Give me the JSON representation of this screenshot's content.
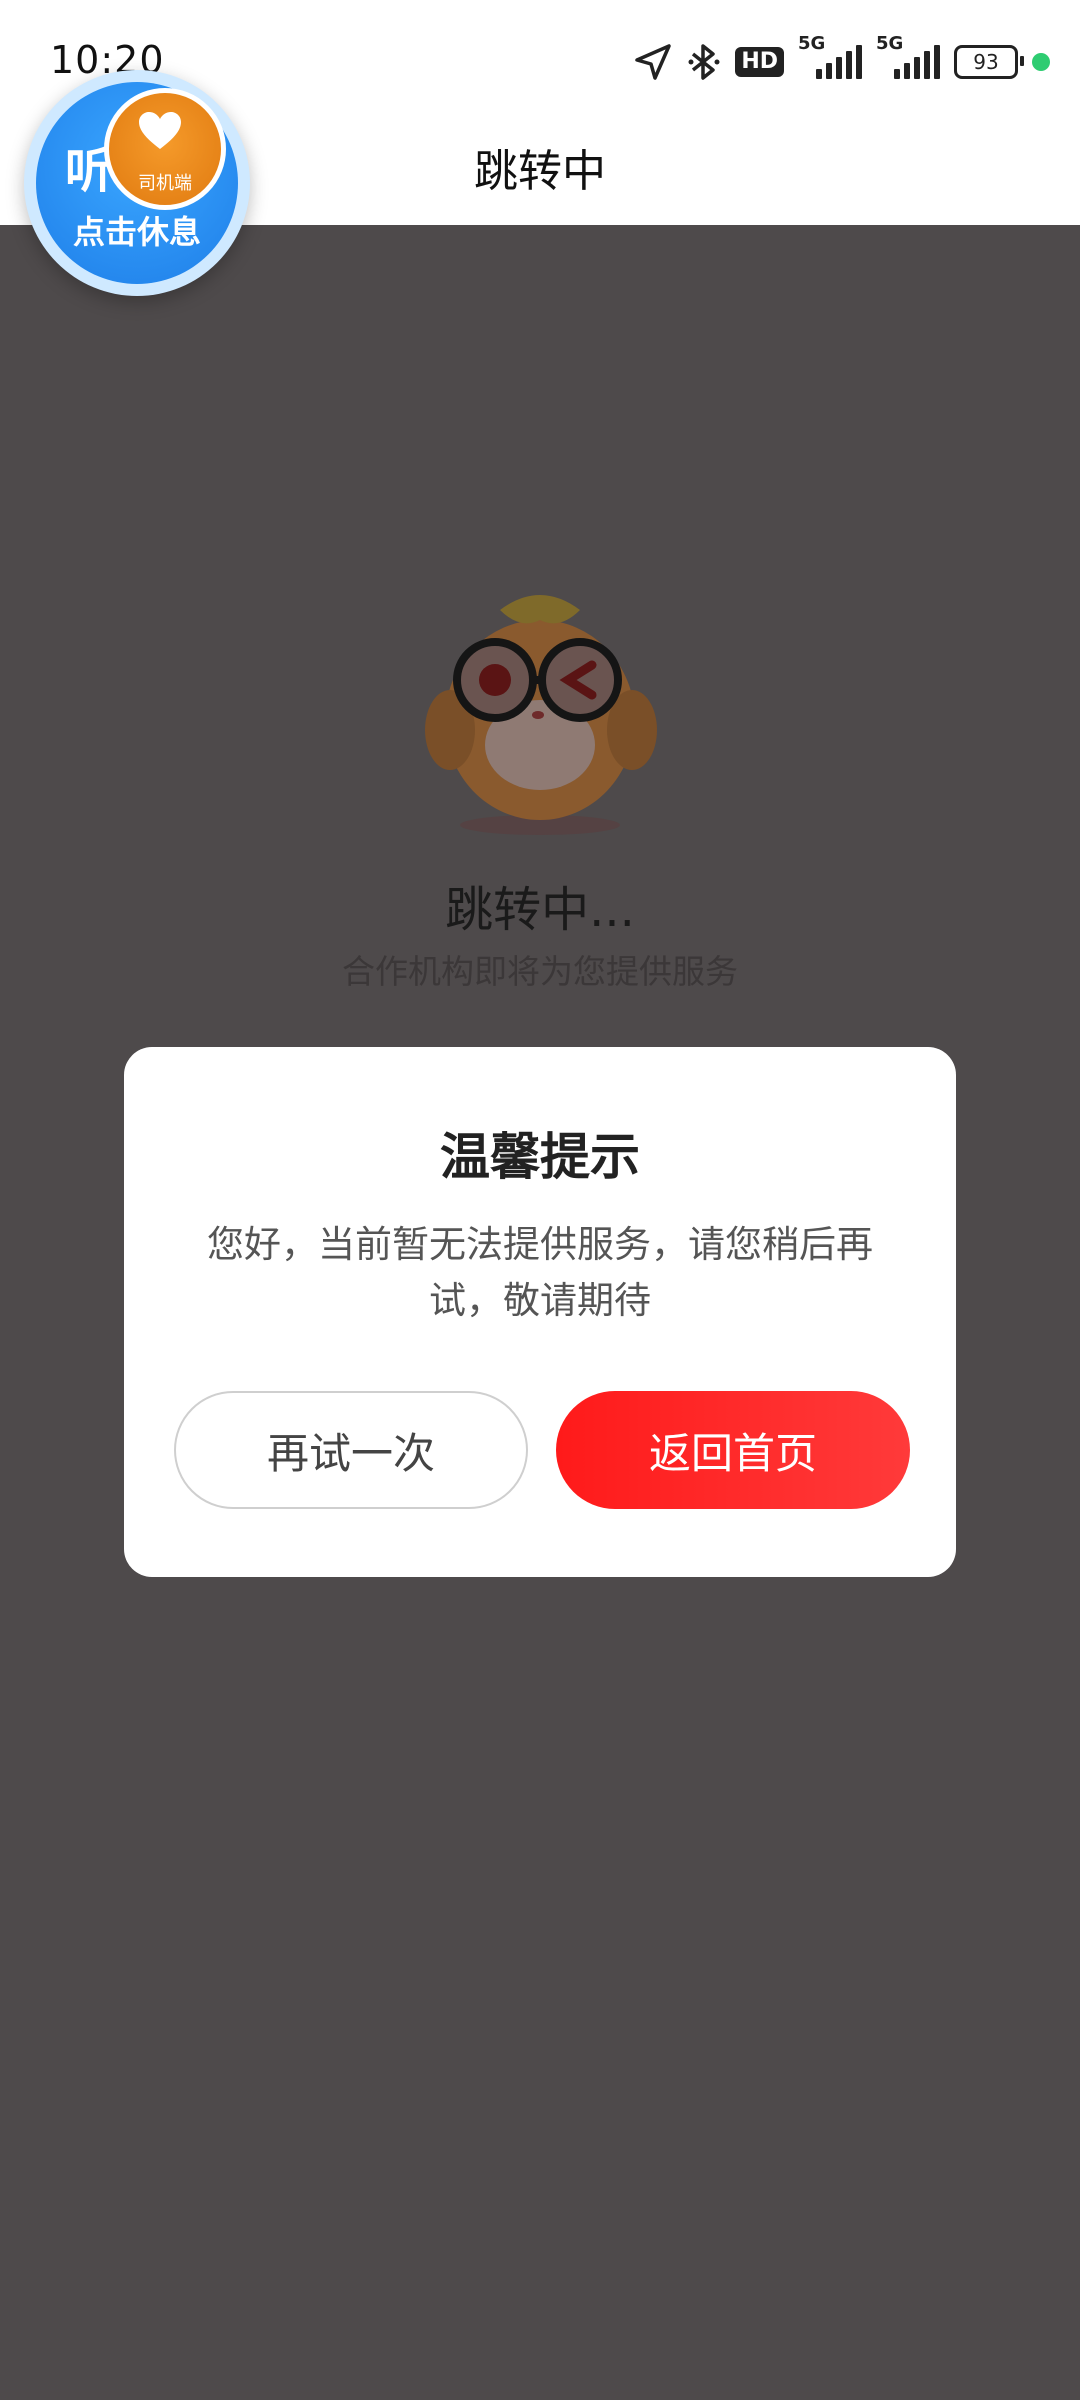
{
  "status_bar": {
    "time": "10:20",
    "hd_label": "HD",
    "network_labels": [
      "5G",
      "5G"
    ],
    "battery": "93",
    "icons": [
      "location-icon",
      "bluetooth-icon",
      "hd-icon",
      "signal-icon",
      "signal-icon",
      "battery-icon"
    ]
  },
  "header": {
    "title": "跳转中"
  },
  "floating_bubble": {
    "status": "听单中",
    "action": "点击休息",
    "logo_text": "司机端"
  },
  "loading": {
    "title": "跳转中...",
    "subtitle": "合作机构即将为您提供服务"
  },
  "dialog": {
    "title": "温馨提示",
    "message": "您好，当前暂无法提供服务，请您稍后再试，敬请期待",
    "retry_button": "再试一次",
    "home_button": "返回首页"
  },
  "colors": {
    "overlay": "#4e4a4b",
    "primary_button": "#ff1a1a",
    "bubble_blue": "#1e7ee8",
    "status_dot": "#2ecc71"
  }
}
